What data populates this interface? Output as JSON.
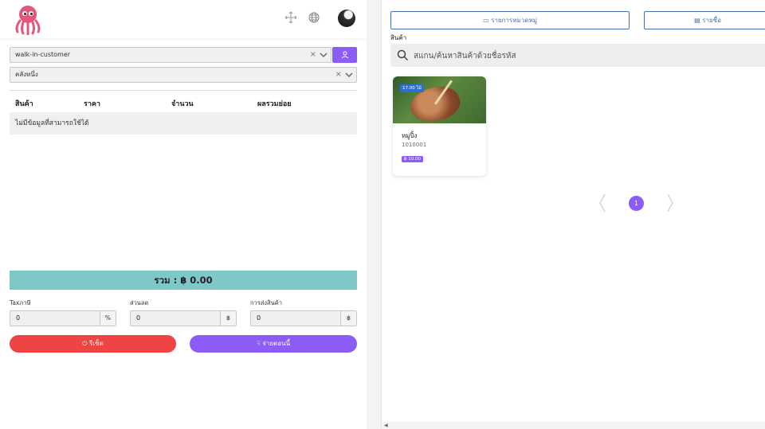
{
  "header": {
    "logo_icon": "octopus-logo-icon",
    "icons": [
      "move-icon",
      "globe-icon"
    ],
    "avatar_icon": "user-avatar"
  },
  "customer_select": {
    "value": "walk-in-customer"
  },
  "warehouse_select": {
    "value": "คลังหนึ่ง"
  },
  "cart_table": {
    "columns": [
      "สินค้า",
      "ราคา",
      "จำนวน",
      "ผลรวมย่อย"
    ],
    "empty_text": "ไม่มีข้อมูลที่สามารถใช้ได้"
  },
  "total": {
    "text": "รวม : ฿ 0.00"
  },
  "fields": {
    "tax": {
      "label": "Taxภาษี",
      "value": "0",
      "suffix": "%"
    },
    "discount": {
      "label": "ส่วนลด",
      "value": "0",
      "suffix": "฿"
    },
    "shipping": {
      "label": "การส่งสินค้า",
      "value": "0",
      "suffix": "฿"
    }
  },
  "buttons": {
    "reset": "รีเซ็ต",
    "pay": "จ่ายตอนนี้"
  },
  "right": {
    "category_btn": "รายการหมวดหมู่",
    "brand_btn": "รายชื่อ",
    "section_label": "สินค้า",
    "search_placeholder": "สแกน/ค้นหาสินค้าด้วยชื่อรหัส",
    "products": [
      {
        "name": "หมูปิ้ง",
        "code": "1010001",
        "stock": "17.00 ไม้",
        "price": "฿ 10.00"
      }
    ],
    "pagination": {
      "current": "1"
    }
  },
  "colors": {
    "accent": "#8b5cf6",
    "total_bar": "#7ec8c8",
    "reset": "#ee4444",
    "link": "#4a6fb5"
  }
}
